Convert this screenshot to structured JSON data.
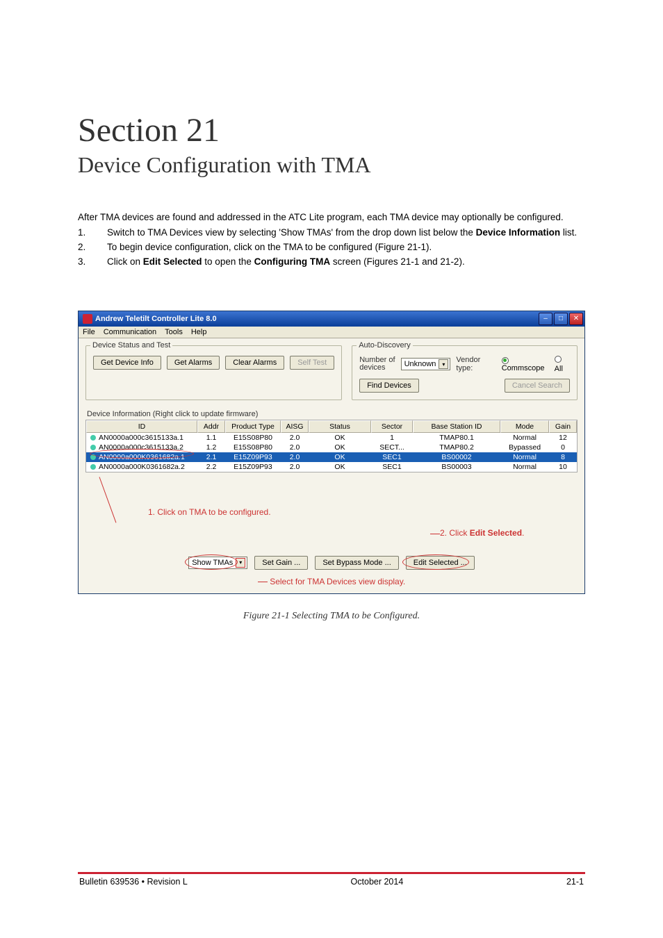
{
  "heading": {
    "section": "Section 21",
    "subtitle": "Device Configuration with TMA"
  },
  "intro": "After TMA devices are found and addressed in the ATC Lite program, each TMA device may optionally be configured.",
  "steps": [
    {
      "n": "1.",
      "text_before": "Switch to TMA Devices view by selecting 'Show TMAs' from the drop down list below the ",
      "bold": "Device Information",
      "text_after": " list."
    },
    {
      "n": "2.",
      "text_before": "To begin device configuration, click on the TMA to be configured (Figure 21-1).",
      "bold": "",
      "text_after": ""
    },
    {
      "n": "3.",
      "text_before": "Click on ",
      "bold": "Edit Selected",
      "text_mid": " to open the ",
      "bold2": "Configuring TMA",
      "text_after": " screen (Figures 21-1 and 21-2)."
    }
  ],
  "window": {
    "title": "Andrew Teletilt Controller Lite 8.0",
    "menus": [
      "File",
      "Communication",
      "Tools",
      "Help"
    ],
    "group_status_legend": "Device Status and Test",
    "status_buttons": {
      "get_info": "Get Device Info",
      "get_alarms": "Get Alarms",
      "clear_alarms": "Clear Alarms",
      "self_test": "Self Test"
    },
    "group_discovery_legend": "Auto-Discovery",
    "discovery": {
      "numdev_label": "Number of\ndevices",
      "numdev_value": "Unknown",
      "vendor_label": "Vendor type:",
      "vendor_commscope": "Commscope",
      "vendor_all": "All",
      "find_btn": "Find Devices",
      "cancel_btn": "Cancel Search"
    },
    "devinfo_label": "Device Information (Right click to update firmware)",
    "columns": [
      "ID",
      "Addr",
      "Product Type",
      "AISG",
      "Status",
      "Sector",
      "Base Station ID",
      "Mode",
      "Gain"
    ],
    "rows": [
      {
        "id": "AN0000a000c3615133a.1",
        "addr": "1.1",
        "ptype": "E15S08P80",
        "aisg": "2.0",
        "status": "OK",
        "sector": "1",
        "bsid": "TMAP80.1",
        "mode": "Normal",
        "gain": "12",
        "selected": false
      },
      {
        "id": "AN0000a000c3615133a.2",
        "addr": "1.2",
        "ptype": "E15S08P80",
        "aisg": "2.0",
        "status": "OK",
        "sector": "SECT...",
        "bsid": "TMAP80.2",
        "mode": "Bypassed",
        "gain": "0",
        "selected": false
      },
      {
        "id": "AN0000a000K0361682a.1",
        "addr": "2.1",
        "ptype": "E15Z09P93",
        "aisg": "2.0",
        "status": "OK",
        "sector": "SEC1",
        "bsid": "BS00002",
        "mode": "Normal",
        "gain": "8",
        "selected": true
      },
      {
        "id": "AN0000a000K0361682a.2",
        "addr": "2.2",
        "ptype": "E15Z09P93",
        "aisg": "2.0",
        "status": "OK",
        "sector": "SEC1",
        "bsid": "BS00003",
        "mode": "Normal",
        "gain": "10",
        "selected": false
      }
    ],
    "bottom": {
      "show_tmas": "Show TMAs",
      "set_gain": "Set Gain ...",
      "set_bypass": "Set Bypass Mode ...",
      "edit_selected": "Edit Selected ..."
    },
    "annotations": {
      "click_tma": "1. Click on TMA to be configured.",
      "click_edit": "2. Click ",
      "click_edit_bold": "Edit Selected",
      "click_edit_after": ".",
      "select_display": "Select for TMA Devices view display."
    }
  },
  "caption": "Figure 21-1 Selecting TMA to be Configured.",
  "footer": {
    "left": "Bulletin 639536  •  Revision L",
    "center": "October 2014",
    "right": "21-1"
  }
}
